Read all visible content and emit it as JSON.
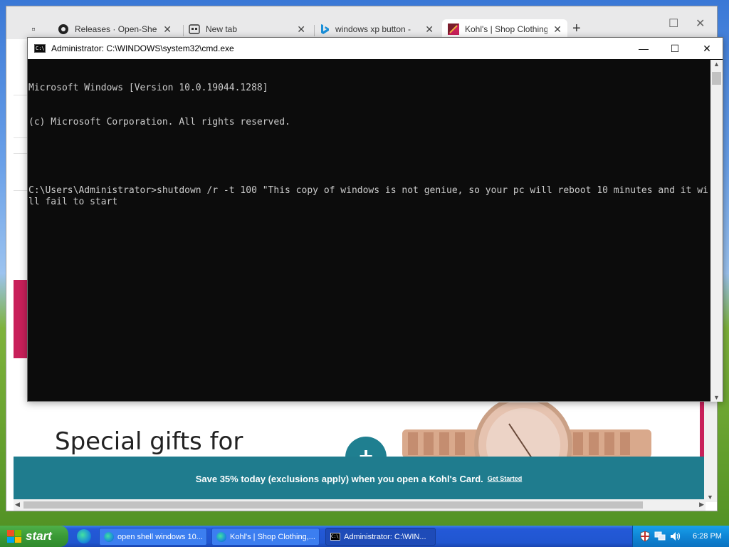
{
  "browser": {
    "tabs": [
      {
        "label": "Releases · Open-Shell",
        "icon": "github-icon"
      },
      {
        "label": "New tab",
        "icon": "new-tab-icon"
      },
      {
        "label": "windows xp button -",
        "icon": "bing-icon"
      },
      {
        "label": "Kohl's | Shop Clothing",
        "icon": "kohls-icon"
      }
    ],
    "close_glyph": "✕",
    "new_tab_glyph": "+",
    "page": {
      "promo_title": "Special gifts for\nthat special",
      "plus_glyph": "+",
      "banner_text": "Save 35% today (exclusions apply) when you open a Kohl's Card.",
      "banner_link": "Get Started"
    }
  },
  "cmd": {
    "title": "Administrator: C:\\WINDOWS\\system32\\cmd.exe",
    "icon_text": "C:\\",
    "minimize_glyph": "—",
    "maximize_glyph": "☐",
    "close_glyph": "✕",
    "lines": [
      "Microsoft Windows [Version 10.0.19044.1288]",
      "(c) Microsoft Corporation. All rights reserved.",
      "",
      "C:\\Users\\Administrator>shutdown /r -t 100 \"This copy of windows is not geniue, so your pc will reboot 10 minutes and it will fail to start"
    ]
  },
  "taskbar": {
    "start_label": "start",
    "items": [
      {
        "label": "open shell windows 10...",
        "icon": "edge-icon"
      },
      {
        "label": "Kohl's | Shop Clothing,...",
        "icon": "edge-icon"
      },
      {
        "label": "Administrator: C:\\WIN...",
        "icon": "cmd-icon"
      }
    ],
    "clock": "6:28 PM"
  },
  "colors": {
    "kohls_accent": "#c8205a",
    "banner_teal": "#1f7c8e",
    "xp_taskbar": "#2459d8",
    "start_green": "#3a9a36"
  }
}
